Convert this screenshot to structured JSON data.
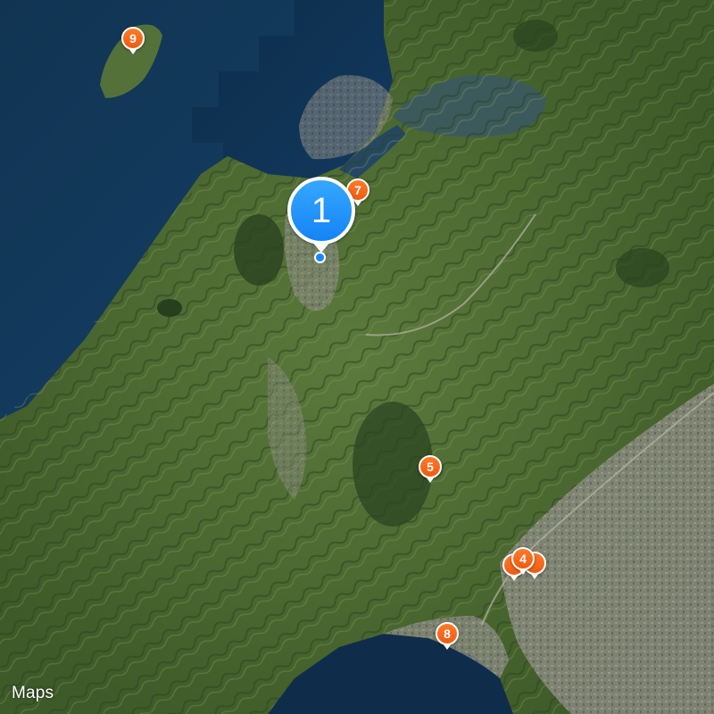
{
  "map": {
    "view": "satellite",
    "attribution": {
      "icon": "apple-logo-icon",
      "logo_glyph": "",
      "label": "Maps"
    },
    "markers": [
      {
        "id": "marker-1",
        "label": "1",
        "kind": "cluster",
        "color": "#1a86f4"
      },
      {
        "id": "marker-4",
        "label": "4",
        "kind": "pin",
        "color": "#f05a10",
        "stacked": true
      },
      {
        "id": "marker-5",
        "label": "5",
        "kind": "pin",
        "color": "#f05a10"
      },
      {
        "id": "marker-7",
        "label": "7",
        "kind": "pin",
        "color": "#f05a10"
      },
      {
        "id": "marker-8",
        "label": "8",
        "kind": "pin",
        "color": "#f05a10"
      },
      {
        "id": "marker-9",
        "label": "9",
        "kind": "pin",
        "color": "#f05a10"
      }
    ],
    "colors": {
      "sea_deep": "#0e2a45",
      "sea": "#123a5c",
      "land": "#4d6a33",
      "urban": "#8f8f86",
      "pin": "#f05a10",
      "cluster": "#1a86f4"
    }
  }
}
